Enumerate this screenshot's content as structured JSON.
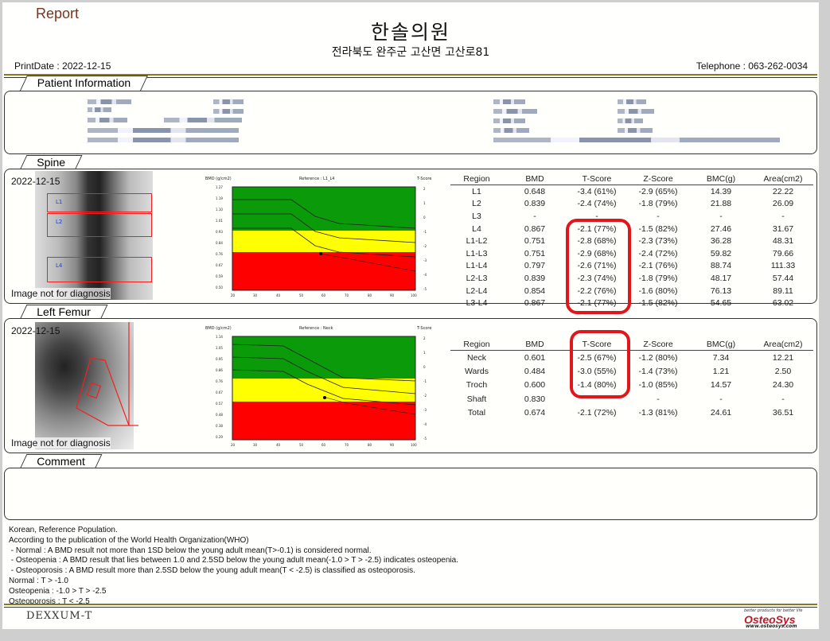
{
  "header": {
    "report_label": "Report",
    "clinic_name": "한솔의원",
    "address": "전라북도 완주군 고산면 고산로81",
    "print_date": "PrintDate : 2022-12-15",
    "telephone": "Telephone : 063-262-0034"
  },
  "patient": {
    "tab": "Patient Information"
  },
  "spine": {
    "tab": "Spine",
    "date": "2022-12-15",
    "not_for_diagnosis": "Image not for diagnosis",
    "roi_labels": [
      "L1",
      "L2",
      "L4"
    ],
    "chart": {
      "y_label": "BMD (g/cm2)",
      "reference": "Reference : L1_L4",
      "t_label": "T-Score",
      "y_ticks": [
        "1.27",
        "1.19",
        "1.10",
        "1.01",
        "0.93",
        "0.84",
        "0.76",
        "0.67",
        "0.59",
        "0.50"
      ],
      "t_ticks": [
        "2",
        "1",
        "0",
        "-1",
        "-2",
        "-3",
        "-4",
        "-5"
      ],
      "x_ticks": [
        "20",
        "30",
        "40",
        "50",
        "60",
        "70",
        "80",
        "90",
        "100"
      ]
    },
    "table": {
      "headers": [
        "Region",
        "BMD",
        "T-Score",
        "Z-Score",
        "BMC(g)",
        "Area(cm2)"
      ],
      "rows": [
        [
          "L1",
          "0.648",
          "-3.4 (61%)",
          "-2.9 (65%)",
          "14.39",
          "22.22"
        ],
        [
          "L2",
          "0.839",
          "-2.4 (74%)",
          "-1.8 (79%)",
          "21.88",
          "26.09"
        ],
        [
          "L3",
          "-",
          "-",
          "-",
          "-",
          "-"
        ],
        [
          "L4",
          "0.867",
          "-2.1 (77%)",
          "-1.5 (82%)",
          "27.46",
          "31.67"
        ],
        [
          "L1-L2",
          "0.751",
          "-2.8 (68%)",
          "-2.3 (73%)",
          "36.28",
          "48.31"
        ],
        [
          "L1-L3",
          "0.751",
          "-2.9 (68%)",
          "-2.4 (72%)",
          "59.82",
          "79.66"
        ],
        [
          "L1-L4",
          "0.797",
          "-2.6 (71%)",
          "-2.1 (76%)",
          "88.74",
          "111.33"
        ],
        [
          "L2-L3",
          "0.839",
          "-2.3 (74%)",
          "-1.8 (79%)",
          "48.17",
          "57.44"
        ],
        [
          "L2-L4",
          "0.854",
          "-2.2 (76%)",
          "-1.6 (80%)",
          "76.13",
          "89.11"
        ],
        [
          "L3-L4",
          "0.867",
          "-2.1 (77%)",
          "-1.5 (82%)",
          "54.65",
          "63.02"
        ]
      ]
    }
  },
  "femur": {
    "tab": "Left Femur",
    "date": "2022-12-15",
    "not_for_diagnosis": "Image not for diagnosis",
    "chart": {
      "y_label": "BMD (g/cm2)",
      "reference": "Reference : Neck",
      "t_label": "T-Score",
      "y_ticks": [
        "1.14",
        "1.05",
        "0.95",
        "0.86",
        "0.76",
        "0.67",
        "0.57",
        "0.48",
        "0.38",
        "0.29"
      ],
      "t_ticks": [
        "2",
        "1",
        "0",
        "-1",
        "-2",
        "-3",
        "-4",
        "-5"
      ],
      "x_ticks": [
        "20",
        "30",
        "40",
        "50",
        "60",
        "70",
        "80",
        "90",
        "100"
      ]
    },
    "table": {
      "headers": [
        "Region",
        "BMD",
        "T-Score",
        "Z-Score",
        "BMC(g)",
        "Area(cm2)"
      ],
      "rows": [
        [
          "Neck",
          "0.601",
          "-2.5 (67%)",
          "-1.2 (80%)",
          "7.34",
          "12.21"
        ],
        [
          "Wards",
          "0.484",
          "-3.0 (55%)",
          "-1.4 (73%)",
          "1.21",
          "2.50"
        ],
        [
          "Troch",
          "0.600",
          "-1.4 (80%)",
          "-1.0 (85%)",
          "14.57",
          "24.30"
        ],
        [
          "Shaft",
          "0.830",
          "",
          "-",
          "-",
          "-"
        ],
        [
          "Total",
          "0.674",
          "-2.1 (72%)",
          "-1.3 (81%)",
          "24.61",
          "36.51"
        ]
      ]
    }
  },
  "comment": {
    "tab": "Comment"
  },
  "notes": [
    "Korean, Reference Population.",
    "According to the publication of the World Health Organization(WHO)",
    " - Normal : A BMD result not more than 1SD below the young adult mean(T>-0.1) is considered normal.",
    " - Osteopenia : A BMD result that lies between 1.0 and 2.5SD below the young adult mean(-1.0 > T > -2.5) indicates osteopenia.",
    " - Osteoporosis : A BMD result more than 2.5SD below the young adult mean(T < -2.5) is classified as osteoporosis.",
    "Normal : T > -1.0",
    "Osteopenia : -1.0 > T > -2.5",
    "Osteoporosis : T < -2.5"
  ],
  "footer": {
    "left_logo": "DEXXUM-T",
    "right_tagline": "better products for better life",
    "right_logo": "OsteoSys",
    "right_url": "www.osteosys.com"
  },
  "colors": {
    "normal": "#0a9a0a",
    "osteopenia": "#ffff00",
    "osteoporosis": "#ff0000",
    "highlight": "#e0161b",
    "accent": "#7a3320"
  }
}
